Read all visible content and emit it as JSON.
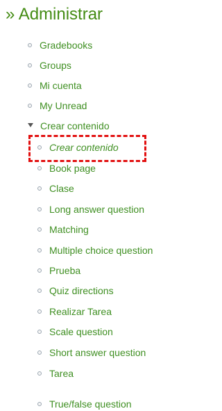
{
  "menu": {
    "title": "» Administrar",
    "items": [
      {
        "label": "Gradebooks"
      },
      {
        "label": "Groups"
      },
      {
        "label": "Mi cuenta"
      },
      {
        "label": "My Unread"
      },
      {
        "label": "Crear contenido",
        "expanded": true,
        "children": [
          {
            "label": "Crear contenido",
            "active": true
          },
          {
            "label": "Book page"
          },
          {
            "label": "Clase"
          },
          {
            "label": "Long answer question"
          },
          {
            "label": "Matching"
          },
          {
            "label": "Multiple choice question"
          },
          {
            "label": "Prueba"
          },
          {
            "label": "Quiz directions"
          },
          {
            "label": "Realizar Tarea"
          },
          {
            "label": "Scale question"
          },
          {
            "label": "Short answer question"
          },
          {
            "label": "Tarea"
          },
          {
            "label": "True/false question"
          }
        ]
      }
    ]
  },
  "colors": {
    "link": "#3f8f22",
    "title": "#448c14",
    "highlight_border": "#e20f0f"
  }
}
